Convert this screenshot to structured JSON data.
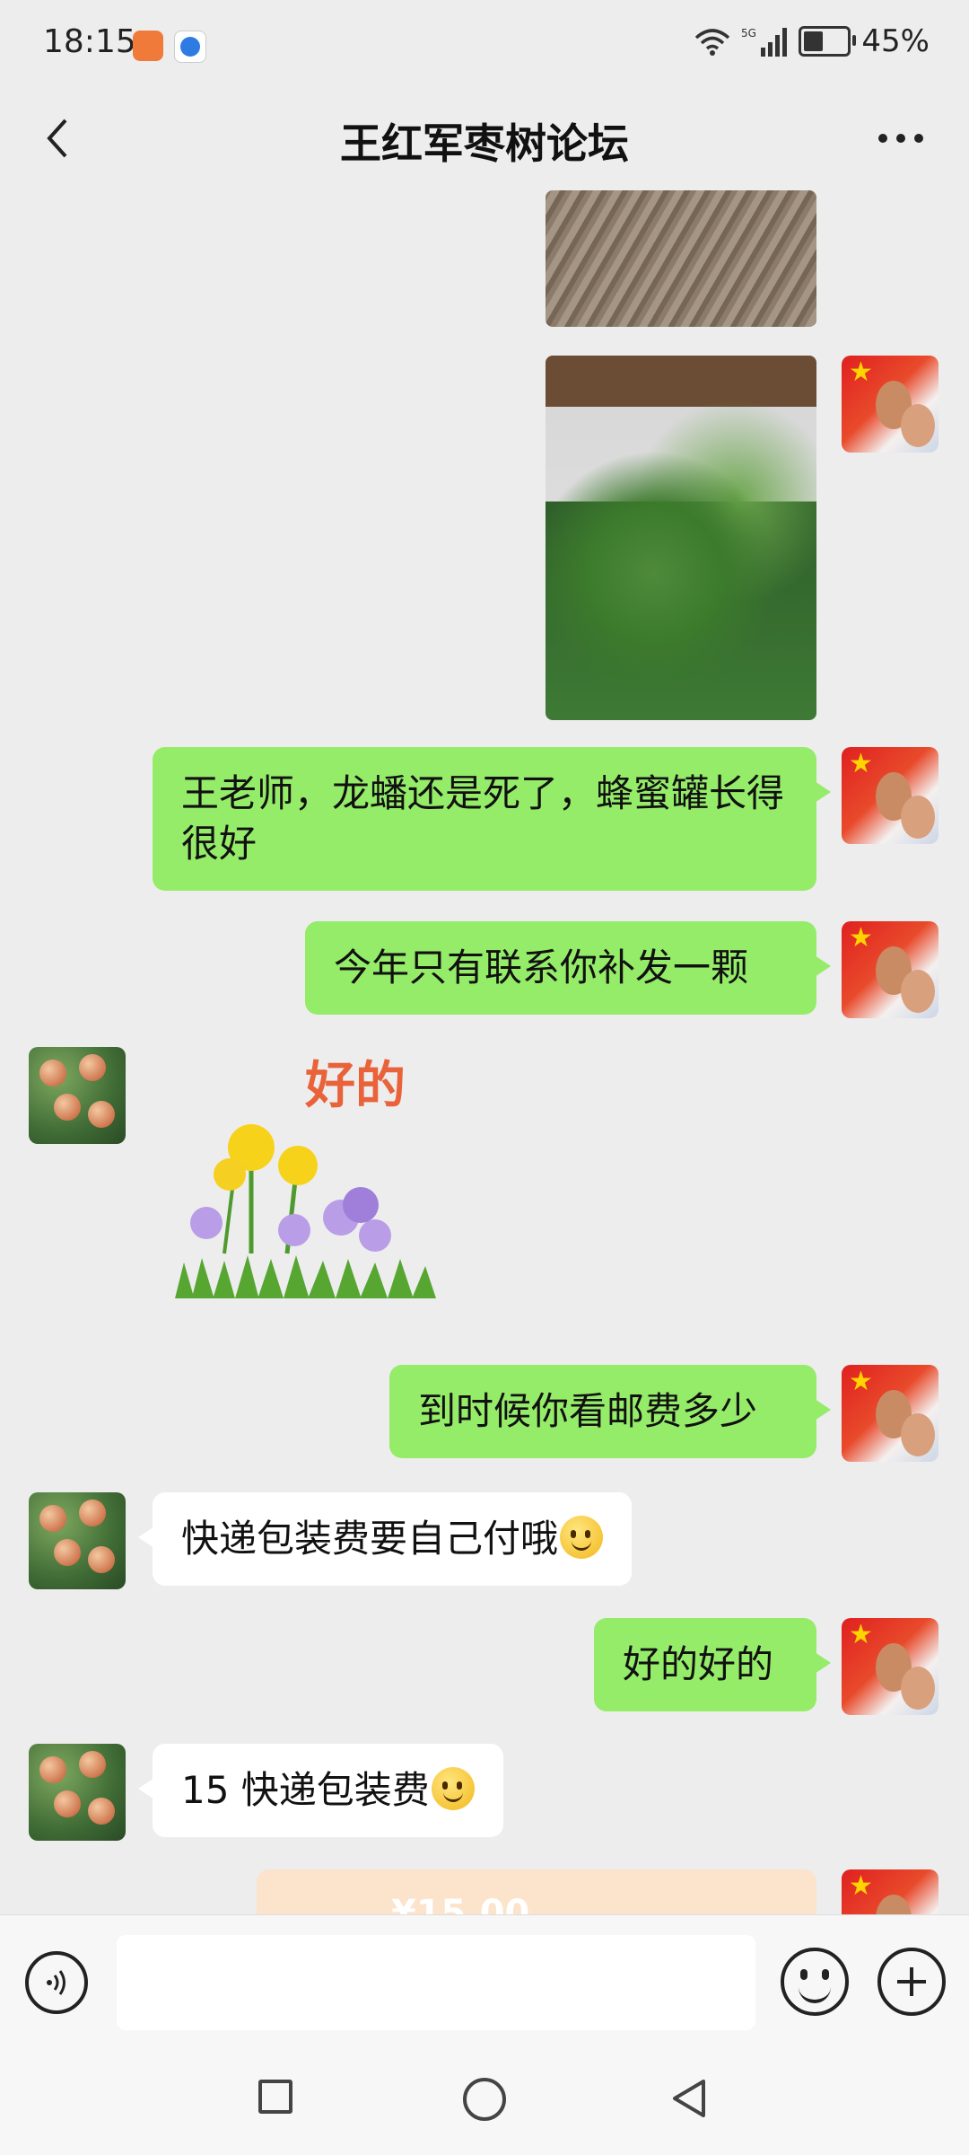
{
  "status_bar": {
    "time": "18:15",
    "network": "5G",
    "battery_text": "45%",
    "battery_level": 0.45
  },
  "header": {
    "title": "王红军枣树论坛"
  },
  "messages": [
    {
      "sender": "me",
      "type": "image",
      "content": "plant-soil-photo"
    },
    {
      "sender": "me",
      "type": "image",
      "content": "green-bush-photo"
    },
    {
      "sender": "me",
      "type": "text",
      "text": "王老师，龙蟠还是死了，蜂蜜罐长得很好"
    },
    {
      "sender": "me",
      "type": "text",
      "text": "今年只有联系你补发一颗"
    },
    {
      "sender": "other",
      "type": "sticker",
      "text": "好的"
    },
    {
      "sender": "me",
      "type": "text",
      "text": "到时候你看邮费多少"
    },
    {
      "sender": "other",
      "type": "text",
      "text": "快递包装费要自己付哦"
    },
    {
      "sender": "me",
      "type": "text",
      "text": "好的好的"
    },
    {
      "sender": "other",
      "type": "text",
      "text": "15 快递包装费"
    },
    {
      "sender": "me",
      "type": "transfer",
      "text": "¥15.00"
    }
  ],
  "colors": {
    "my_bubble": "#95ec69",
    "their_bubble": "#ffffff",
    "background": "#ededed"
  },
  "input": {
    "placeholder": ""
  }
}
